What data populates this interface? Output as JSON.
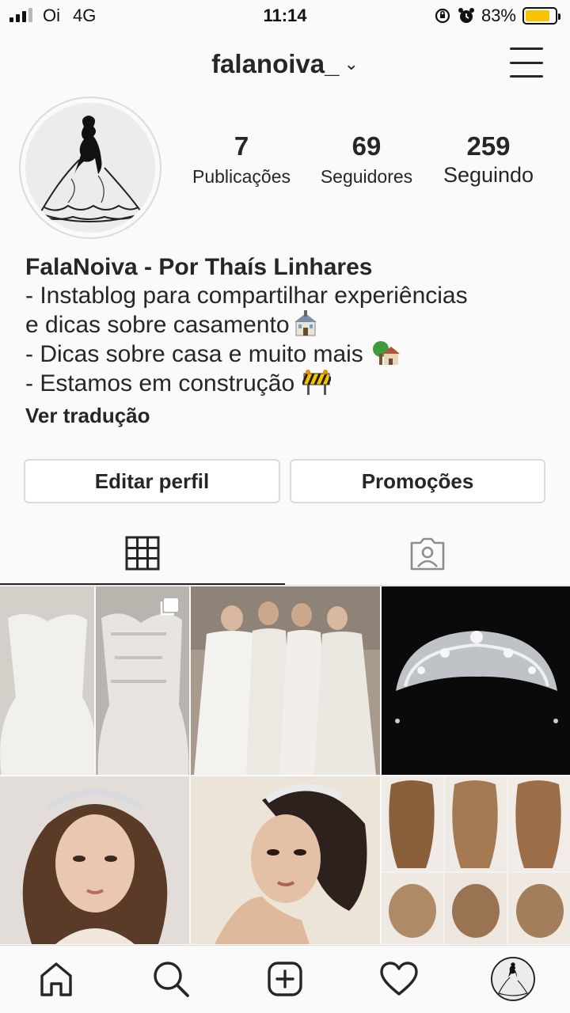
{
  "status_bar": {
    "carrier": "Oi",
    "network": "4G",
    "time": "11:14",
    "battery_percent": "83%",
    "battery_level": 0.83,
    "battery_color": "#f7c300"
  },
  "header": {
    "username": "falanoiva_",
    "dropdown_icon": "chevron-down-icon",
    "menu_icon": "hamburger-menu-icon"
  },
  "profile": {
    "stats": [
      {
        "value": "7",
        "label": "Publicações"
      },
      {
        "value": "69",
        "label": "Seguidores"
      },
      {
        "value": "259",
        "label": "Seguindo"
      }
    ],
    "name": "FalaNoiva - Por Thaís Linhares",
    "bio_lines": [
      "- Instablog para compartilhar experiências",
      "e dicas sobre casamento",
      "- Dicas sobre casa e muito mais ",
      "- Estamos em construção "
    ],
    "see_translation": "Ver tradução"
  },
  "buttons": {
    "edit_profile": "Editar perfil",
    "promotions": "Promoções"
  },
  "tabs": [
    {
      "icon": "grid-icon",
      "active": true
    },
    {
      "icon": "tagged-person-icon",
      "active": false
    }
  ],
  "posts": [
    {
      "subject": "lace mermaid wedding dress",
      "multiple": true
    },
    {
      "subject": "brides in white gowns"
    },
    {
      "subject": "crystal tiara on black"
    },
    {
      "subject": "bride with tiara"
    },
    {
      "subject": "bride with crown updo"
    },
    {
      "subject": "hairstyle collage"
    }
  ],
  "bottom_nav": [
    {
      "icon": "home-icon"
    },
    {
      "icon": "search-icon"
    },
    {
      "icon": "add-post-icon"
    },
    {
      "icon": "heart-icon"
    },
    {
      "icon": "profile-avatar"
    }
  ],
  "colors": {
    "background": "#fafafa",
    "text": "#262626",
    "border": "#dbdbdb"
  }
}
